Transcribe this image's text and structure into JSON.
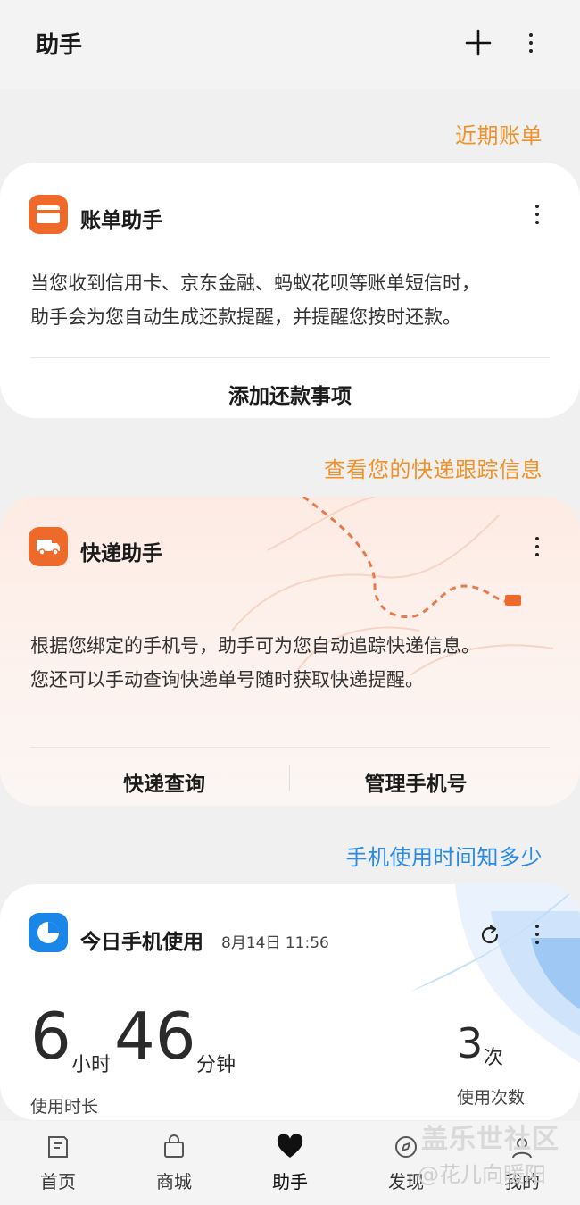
{
  "header": {
    "title": "助手"
  },
  "bill_card": {
    "section_link": "近期账单",
    "title": "账单助手",
    "description_line1": "当您收到信用卡、京东金融、蚂蚁花呗等账单短信时，",
    "description_line2": "助手会为您自动生成还款提醒，并提醒您按时还款。",
    "action": "添加还款事项"
  },
  "express_card": {
    "section_link": "查看您的快递跟踪信息",
    "title": "快递助手",
    "description_line1": "根据您绑定的手机号，助手可为您自动追踪快递信息。",
    "description_line2": "您还可以手动查询快递单号随时获取快递提醒。",
    "action_left": "快递查询",
    "action_right": "管理手机号"
  },
  "usage_card": {
    "section_link": "手机使用时间知多少",
    "title": "今日手机使用",
    "timestamp": "8月14日 11:56",
    "hours": "6",
    "hours_unit": "小时",
    "minutes": "46",
    "minutes_unit": "分钟",
    "duration_label": "使用时长",
    "count": "3",
    "count_unit": "次",
    "count_label": "使用次数"
  },
  "bottom_nav": [
    {
      "label": "首页",
      "icon": "home-icon"
    },
    {
      "label": "商城",
      "icon": "shopping-bag-icon"
    },
    {
      "label": "助手",
      "icon": "heart-icon"
    },
    {
      "label": "发现",
      "icon": "compass-icon"
    },
    {
      "label": "我的",
      "icon": "profile-icon"
    }
  ],
  "watermark": {
    "line1": "盖乐世社区",
    "line2": "@花儿向暖阳"
  },
  "colors": {
    "accent_orange": "#f0922a",
    "accent_blue": "#2a8be6",
    "icon_orange": "#ee6a2b",
    "icon_blue": "#1a86e8"
  }
}
